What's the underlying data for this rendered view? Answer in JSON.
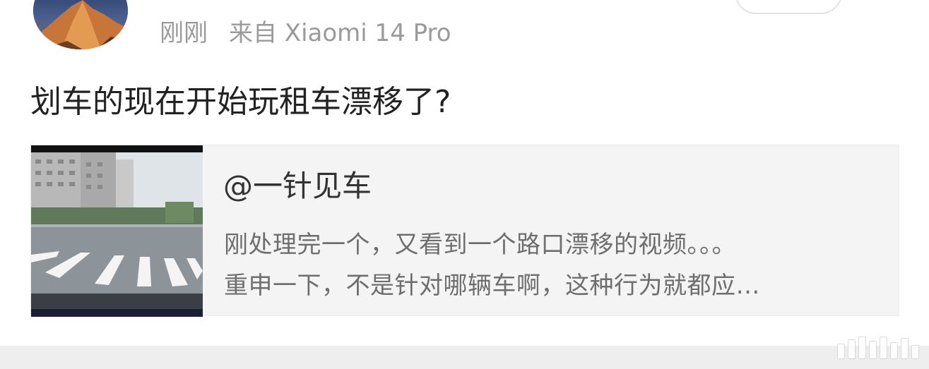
{
  "header": {
    "time": "刚刚",
    "source": "来自 Xiaomi 14 Pro"
  },
  "post": {
    "text": "划车的现在开始玩租车漂移了?"
  },
  "repost": {
    "username": "@一针见车",
    "line1": "刚处理完一个，又看到一个路口漂移的视频。。。",
    "line2": "重申一下，不是针对哪辆车啊，这种行为就都应…"
  },
  "colors": {
    "background": "#ffffff",
    "meta_text": "#9a9a9a",
    "card_background": "#f4f4f4"
  }
}
